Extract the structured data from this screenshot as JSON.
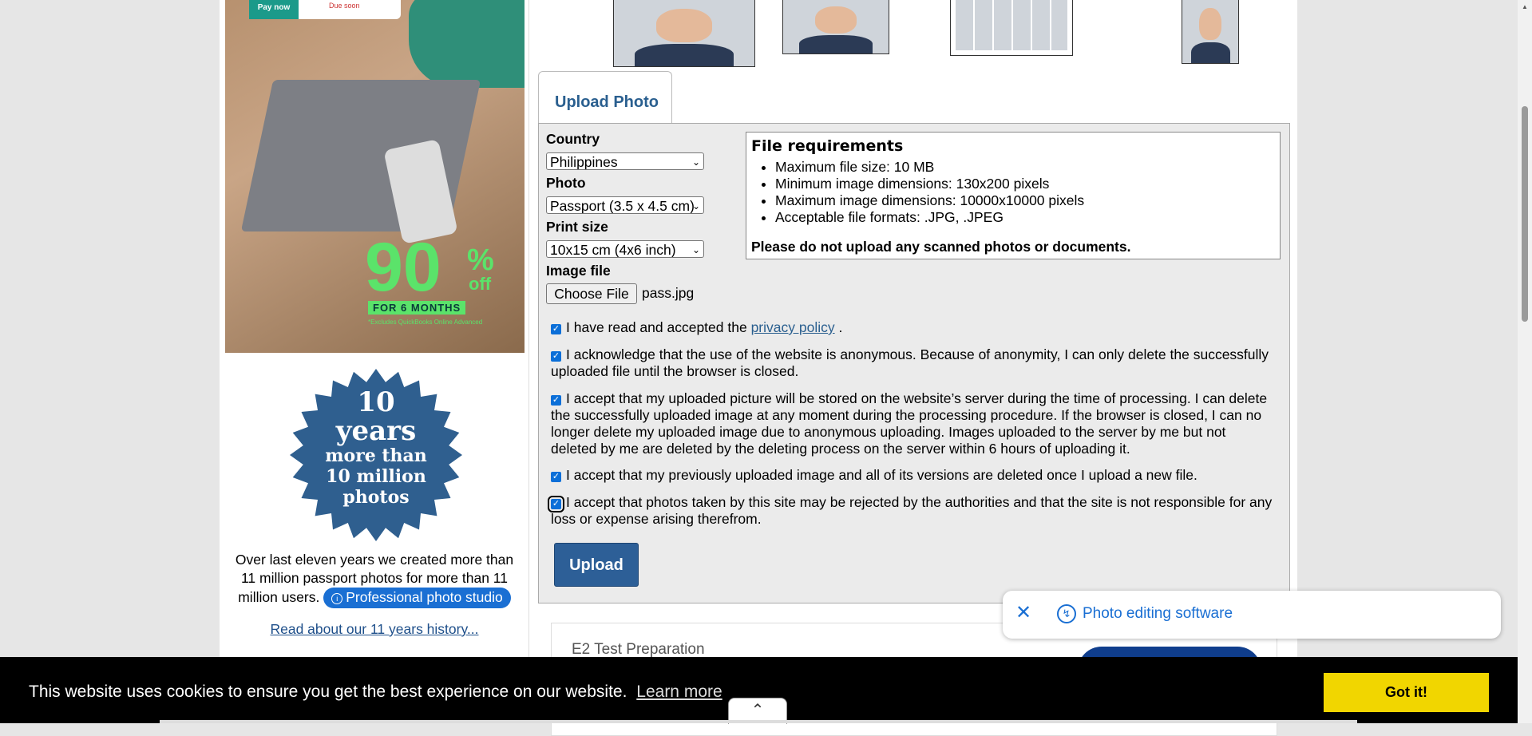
{
  "ad": {
    "pay_now": "Pay now",
    "due_soon": "Due soon",
    "promo_number": "90",
    "promo_percent": "%",
    "promo_off": "off",
    "promo_duration": "FOR 6 MONTHS",
    "promo_fine_print": "*Excludes QuickBooks Online Advanced"
  },
  "badge": {
    "line1": "10",
    "line2": "years",
    "line3": "more than",
    "line4": "10 million",
    "line5": "photos",
    "color": "#2f5f8f"
  },
  "history": {
    "text": "Over last eleven years we created more than 11 million passport photos for more than 11 million users.",
    "studio_button": "Professional photo studio",
    "link": "Read about our 11 years history..."
  },
  "tab": {
    "label": "Upload Photo"
  },
  "form": {
    "country_label": "Country",
    "country_value": "Philippines",
    "photo_label": "Photo",
    "photo_value": "Passport (3.5 x 4.5 cm)",
    "print_label": "Print size",
    "print_value": "10x15 cm    (4x6 inch)",
    "image_label": "Image file",
    "choose_file": "Choose File",
    "file_name": "pass.jpg"
  },
  "requirements": {
    "title": "File requirements",
    "items": [
      "Maximum file size: 10 MB",
      "Minimum image dimensions: 130x200 pixels",
      "Maximum image dimensions: 10000x10000 pixels",
      "Acceptable file formats: .JPG, .JPEG"
    ],
    "warning": "Please do not upload any scanned photos or documents."
  },
  "consents": {
    "c1_prefix": "I have read and accepted the",
    "c1_link": "privacy policy",
    "c1_suffix": ".",
    "c2": "I acknowledge that the use of the website is anonymous. Because of anonymity, I can only delete the successfully uploaded file until the browser is closed.",
    "c3": "I accept that my uploaded picture will be stored on the website’s server during the time of processing. I can delete the successfully uploaded image at any moment during the processing procedure. If the browser is closed, I can no longer delete my uploaded image due to anonymous uploading. Images uploaded to the server by me but not deleted by me are deleted by the deleting process on the server within 6 hours of uploading it.",
    "c4": "I accept that my previously uploaded image and all of its versions are deleted once I upload a new file.",
    "c5": "I accept that photos taken by this site may be rejected by the authorities and that the site is not responsible for any loss or expense arising therefrom."
  },
  "upload_button": "Upload",
  "card": {
    "title": "E2 Test Preparation"
  },
  "toast": {
    "text": "Photo editing software"
  },
  "cookie": {
    "message": "This website uses cookies to ensure you get the best experience on our website.",
    "learn_more": "Learn more",
    "got_it": "Got it!"
  },
  "colors": {
    "accent_blue": "#2d5f97",
    "link_blue": "#1a6fd3",
    "cookie_button": "#f1d600",
    "promo_green": "#5be36a"
  }
}
